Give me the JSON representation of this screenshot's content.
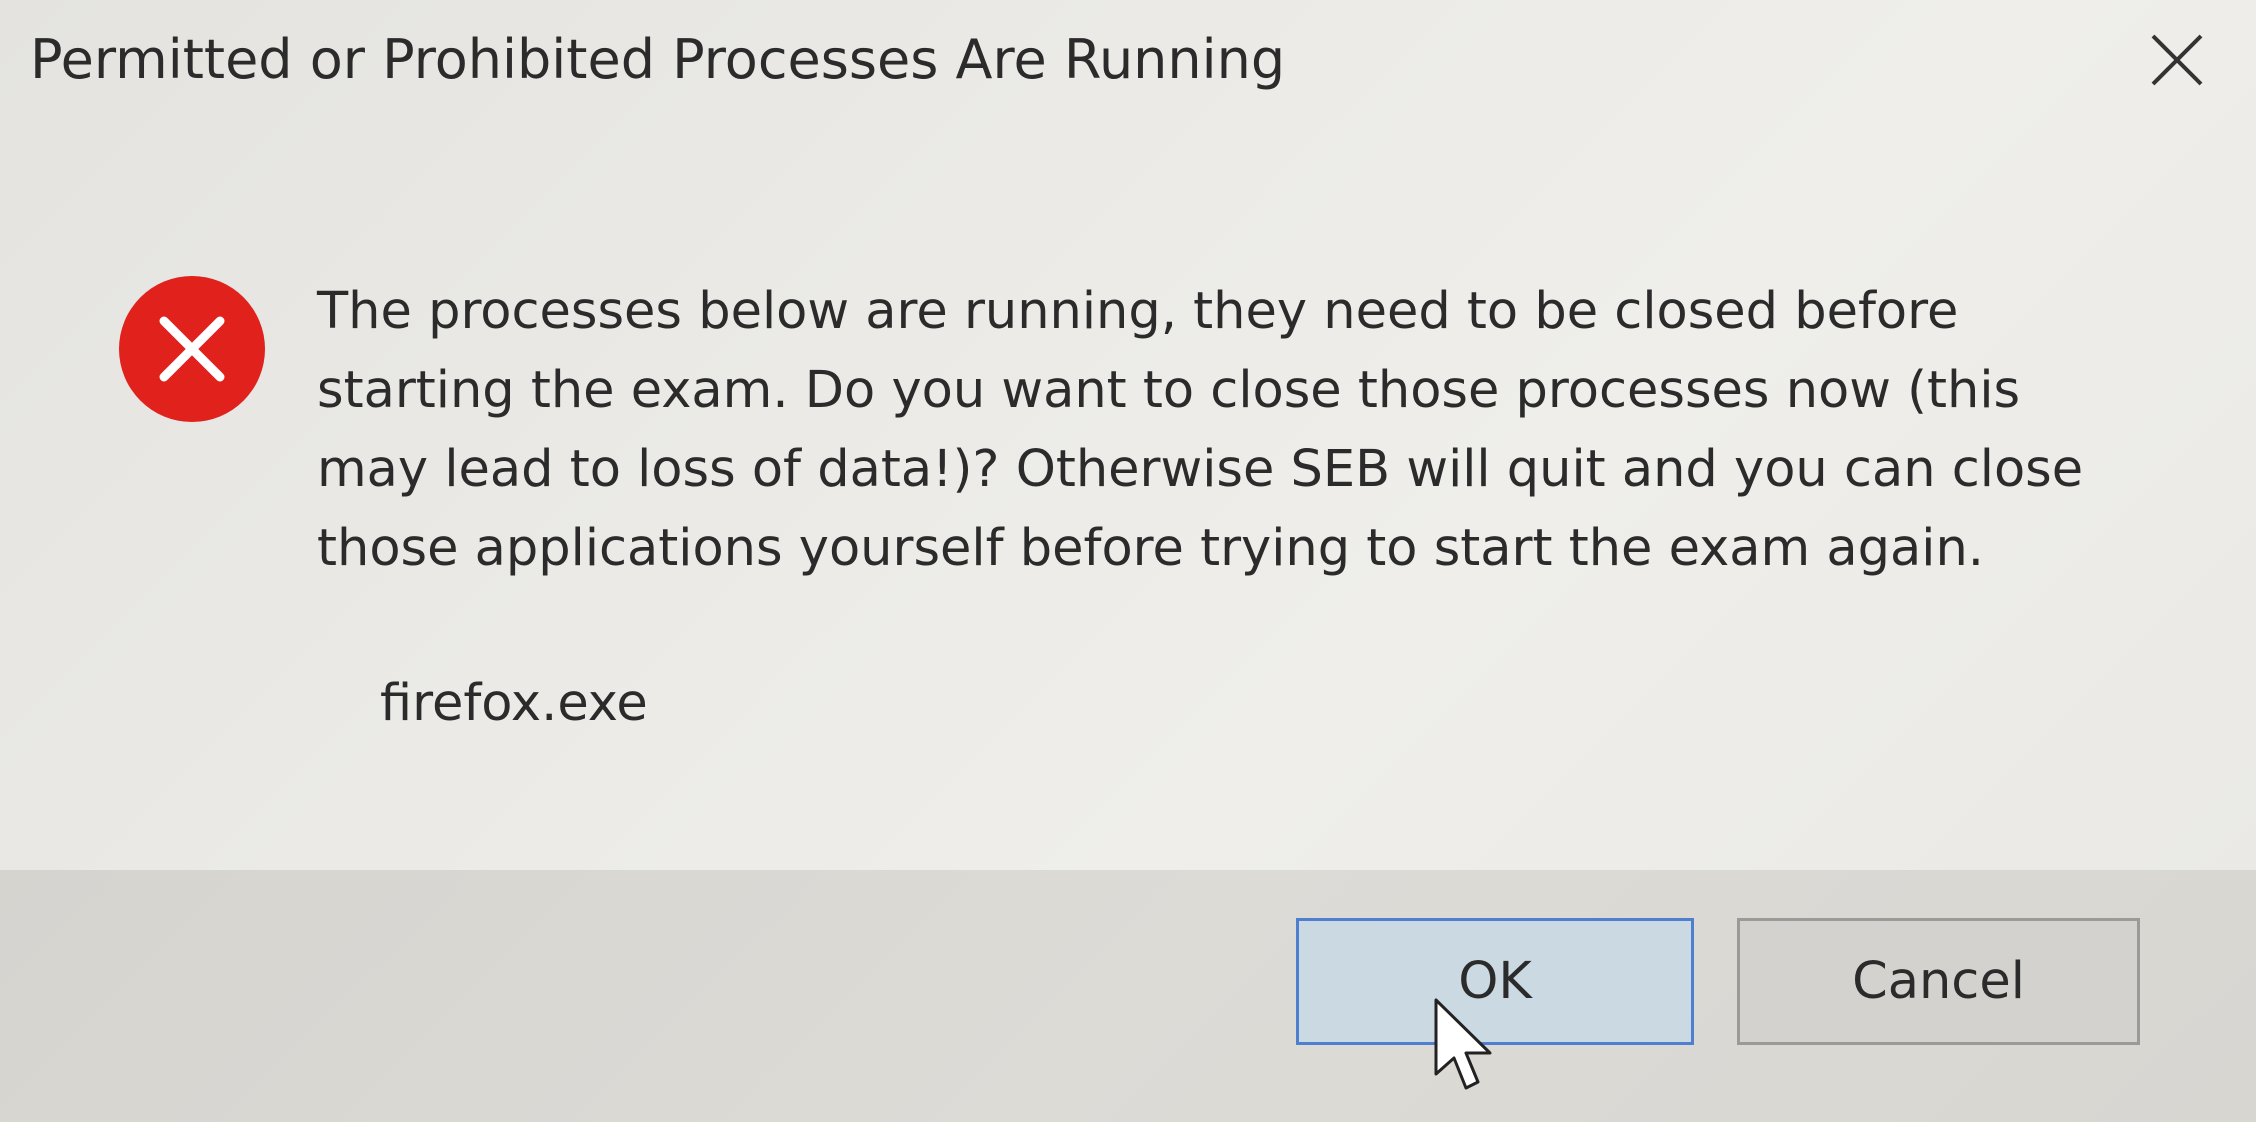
{
  "dialog": {
    "title": "Permitted or Prohibited Processes Are Running",
    "close_icon": "close-icon",
    "error_icon": "error-circle-x-icon",
    "message_lines": [
      "The processes below are running, they need to be closed before",
      "starting the exam. Do you want to close those processes now (this",
      "may lead to loss of data!)? Otherwise SEB will quit and you can close",
      "those applications yourself before trying to start the exam again."
    ],
    "processes": [
      "firefox.exe"
    ],
    "buttons": {
      "ok_label": "OK",
      "cancel_label": "Cancel"
    },
    "colors": {
      "error_red": "#e0211c",
      "ok_border": "#4f7fcf",
      "ok_fill": "#cbd9e3"
    }
  }
}
